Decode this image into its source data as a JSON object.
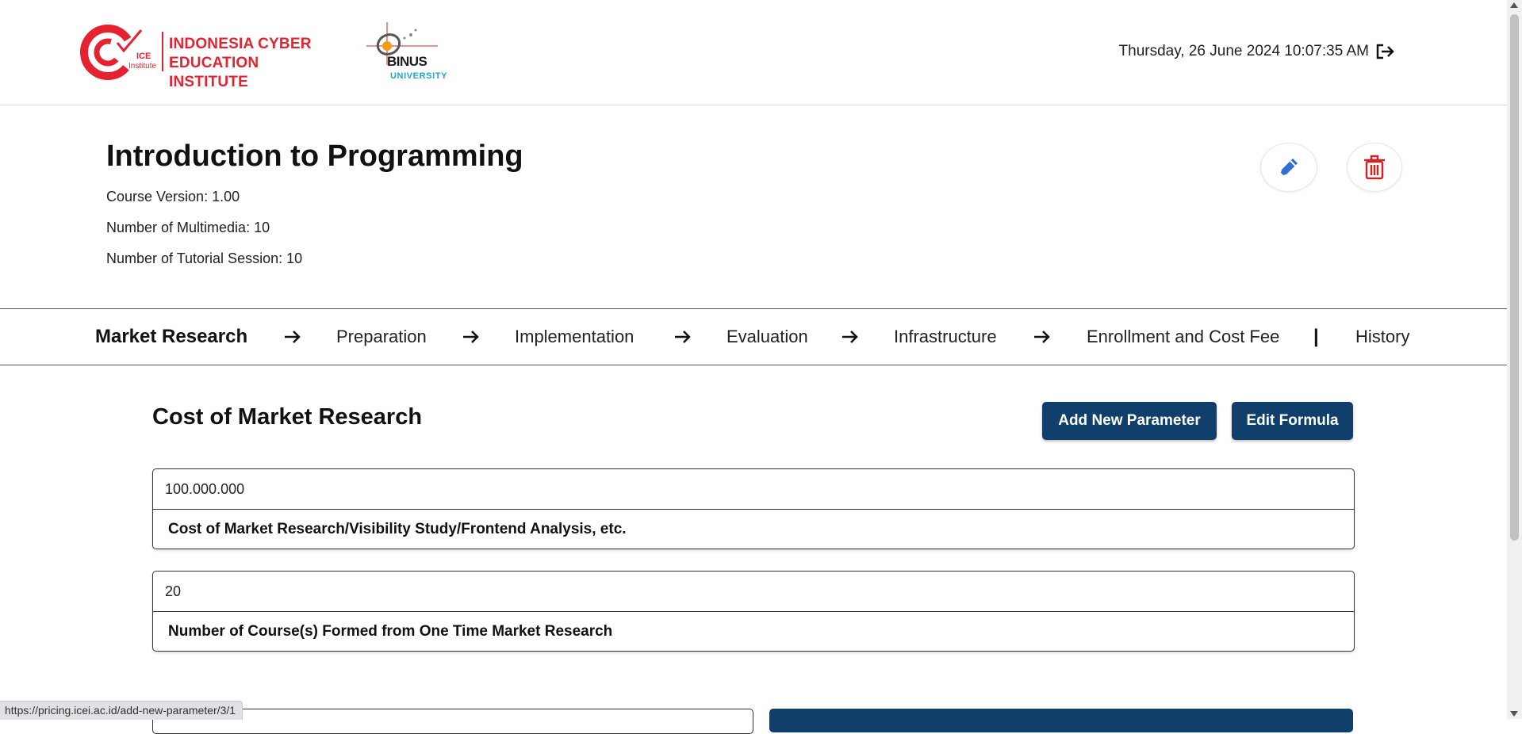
{
  "header": {
    "brand_line1": "INDONESIA CYBER",
    "brand_line2": "EDUCATION INSTITUTE",
    "brand_badge_line1": "ICE",
    "brand_badge_line2": "Institute",
    "partner_name": "BINUS",
    "partner_sub": "UNIVERSITY",
    "datetime": "Thursday, 26 June 2024 10:07:35 AM"
  },
  "course": {
    "title": "Introduction to Programming",
    "version": "Course Version: 1.00",
    "multimedia": "Number of Multimedia: 10",
    "tutorial": "Number of Tutorial Session: 10"
  },
  "nav": {
    "items": [
      {
        "label": "Market Research",
        "active": true
      },
      {
        "label": "Preparation"
      },
      {
        "label": "Implementation"
      },
      {
        "label": "Evaluation"
      },
      {
        "label": "Infrastructure"
      },
      {
        "label": "Enrollment and Cost Fee"
      },
      {
        "label": "History"
      }
    ],
    "separator": "|"
  },
  "section": {
    "title": "Cost of Market Research",
    "add_button": "Add New Parameter",
    "formula_button": "Edit Formula"
  },
  "params": [
    {
      "value": "100.000.000",
      "label": "Cost of Market Research/Visibility Study/Frontend Analysis, etc."
    },
    {
      "value": "20",
      "label": "Number of Course(s) Formed from One Time Market Research"
    }
  ],
  "status_bar": {
    "url": "https://pricing.icei.ac.id/add-new-parameter/3/1"
  },
  "colors": {
    "brand_red": "#e52330",
    "primary_navy": "#0f3f6a",
    "edit_blue": "#2f6fd6",
    "delete_red": "#c62828",
    "binus_blue": "#1fa3d6"
  },
  "icons": {
    "logout": "logout-icon",
    "edit": "pencil-icon",
    "delete": "trash-icon",
    "nav_arrow": "arrow-right-icon"
  }
}
